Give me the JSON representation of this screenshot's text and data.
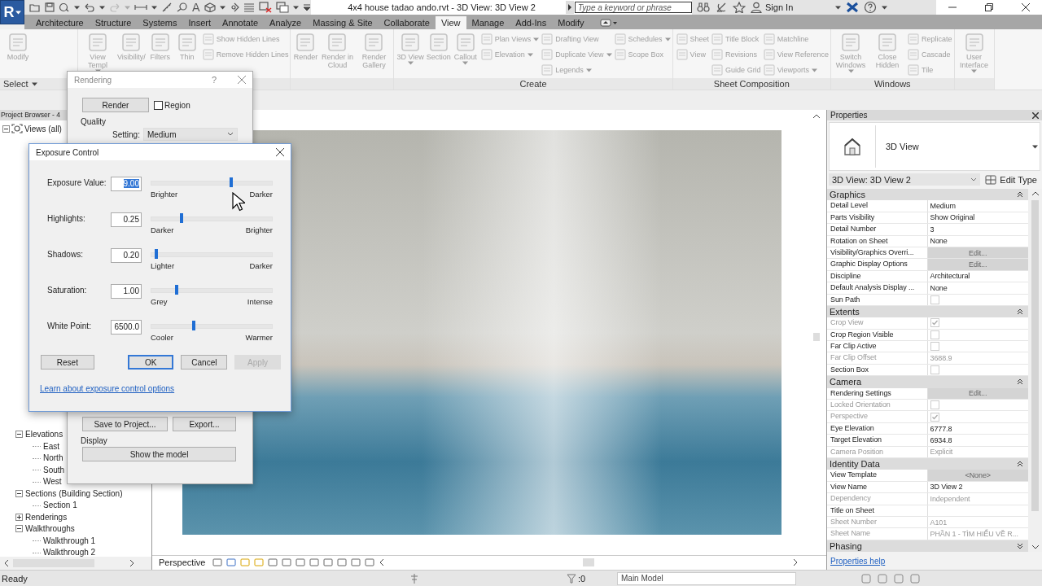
{
  "title_bar": {
    "app_menu": "R",
    "text_tool": "A",
    "title": "4x4 house tadao ando.rvt - 3D View: 3D View 2",
    "search": {
      "placeholder": "Type a keyword or phrase"
    },
    "sign_in": "Sign In"
  },
  "ribbon": {
    "tabs": [
      {
        "label": "Architecture",
        "selected": false
      },
      {
        "label": "Structure",
        "selected": false
      },
      {
        "label": "Systems",
        "selected": false
      },
      {
        "label": "Insert",
        "selected": false
      },
      {
        "label": "Annotate",
        "selected": false
      },
      {
        "label": "Analyze",
        "selected": false
      },
      {
        "label": "Massing & Site",
        "selected": false
      },
      {
        "label": "Collaborate",
        "selected": false
      },
      {
        "label": "View",
        "selected": true
      },
      {
        "label": "Manage",
        "selected": false
      },
      {
        "label": "Add-Ins",
        "selected": false
      },
      {
        "label": "Modify",
        "selected": false
      }
    ],
    "panels": [
      {
        "label": "Select",
        "items": [
          {
            "kind": "large",
            "label": "Modify",
            "menu": false
          }
        ]
      },
      {
        "items": [
          {
            "kind": "large",
            "label": "View Templ",
            "menu": true
          },
          {
            "kind": "large",
            "label": "Visibility/",
            "menu": false
          },
          {
            "kind": "large",
            "label": "Filters",
            "menu": false
          },
          {
            "kind": "large",
            "label": "Thin",
            "menu": false
          },
          {
            "kind": "stack",
            "items": [
              {
                "label": "Show Hidden Lines",
                "menu": false
              },
              {
                "label": "Remove Hidden Lines",
                "menu": false
              }
            ]
          }
        ]
      },
      {
        "items": [
          {
            "kind": "large",
            "label": "Render",
            "menu": false
          },
          {
            "kind": "large",
            "label": "Render in Cloud",
            "menu": false
          },
          {
            "kind": "large",
            "label": "Render Gallery",
            "menu": false
          }
        ]
      },
      {
        "label": "Create",
        "items": [
          {
            "kind": "large",
            "label": "3D View",
            "menu": true
          },
          {
            "kind": "large",
            "label": "Section",
            "menu": false
          },
          {
            "kind": "large",
            "label": "Callout",
            "menu": true
          },
          {
            "kind": "stack",
            "items": [
              {
                "label": "Plan Views",
                "menu": true
              },
              {
                "label": "Elevation",
                "menu": true
              }
            ]
          },
          {
            "kind": "stack",
            "items": [
              {
                "label": "Drafting View",
                "menu": false
              },
              {
                "label": "Duplicate View",
                "menu": true
              },
              {
                "label": "Legends",
                "menu": true
              }
            ]
          },
          {
            "kind": "stack",
            "items": [
              {
                "label": "Schedules",
                "menu": true
              },
              {
                "label": "Scope Box",
                "menu": false
              }
            ]
          }
        ]
      },
      {
        "label": "Sheet Composition",
        "items": [
          {
            "kind": "stack",
            "items": [
              {
                "label": "Sheet",
                "menu": false
              },
              {
                "label": "View",
                "menu": false
              }
            ]
          },
          {
            "kind": "stack",
            "items": [
              {
                "label": "Title Block",
                "menu": false
              },
              {
                "label": "Revisions",
                "menu": false
              },
              {
                "label": "Guide Grid",
                "menu": false
              }
            ]
          },
          {
            "kind": "stack",
            "items": [
              {
                "label": "Matchline",
                "menu": false
              },
              {
                "label": "View Reference",
                "menu": false
              },
              {
                "label": "Viewports",
                "menu": true
              }
            ]
          }
        ]
      },
      {
        "label": "Windows",
        "items": [
          {
            "kind": "large",
            "label": "Switch Windows",
            "menu": true
          },
          {
            "kind": "large",
            "label": "Close Hidden",
            "menu": false
          },
          {
            "kind": "stack",
            "items": [
              {
                "label": "Replicate",
                "menu": false
              },
              {
                "label": "Cascade",
                "menu": false
              },
              {
                "label": "Tile",
                "menu": false
              }
            ]
          }
        ]
      },
      {
        "items": [
          {
            "kind": "large",
            "label": "User Interface",
            "menu": true
          }
        ]
      }
    ]
  },
  "project_browser": {
    "title": "Project Browser - 4",
    "tree": [
      {
        "label": "Views (all)",
        "expanded": true,
        "children": [
          {
            "label": "Elevations",
            "expanded": true,
            "children": [
              {
                "label": "East"
              },
              {
                "label": "North"
              },
              {
                "label": "South"
              },
              {
                "label": "West"
              }
            ]
          },
          {
            "label": "Sections (Building Section)",
            "expanded": true,
            "children": [
              {
                "label": "Section 1"
              }
            ]
          },
          {
            "label": "Renderings",
            "expanded": false
          },
          {
            "label": "Walkthroughs",
            "expanded": true,
            "children": [
              {
                "label": "Walkthrough 1"
              },
              {
                "label": "Walkthrough 2"
              }
            ]
          }
        ]
      }
    ]
  },
  "view": {
    "view_bar": {
      "label": "Perspective"
    }
  },
  "properties": {
    "title": "Properties",
    "type_name": "3D View",
    "instance": "3D View: 3D View 2",
    "edit_type": "Edit Type",
    "groups": [
      {
        "label": "Graphics",
        "expanded": true,
        "rows": [
          {
            "name": "Detail Level",
            "kind": "text",
            "value": "Medium",
            "disabled": false
          },
          {
            "name": "Parts Visibility",
            "kind": "text",
            "value": "Show Original",
            "disabled": false
          },
          {
            "name": "Detail Number",
            "kind": "text",
            "value": "3",
            "disabled": false
          },
          {
            "name": "Rotation on Sheet",
            "kind": "text",
            "value": "None",
            "disabled": false
          },
          {
            "name": "Visibility/Graphics Overri...",
            "kind": "button",
            "value": "Edit...",
            "disabled": false
          },
          {
            "name": "Graphic Display Options",
            "kind": "button",
            "value": "Edit...",
            "disabled": false
          },
          {
            "name": "Discipline",
            "kind": "text",
            "value": "Architectural",
            "disabled": false
          },
          {
            "name": "Default Analysis Display ...",
            "kind": "text",
            "value": "None",
            "disabled": false
          },
          {
            "name": "Sun Path",
            "kind": "checkbox",
            "checked": false,
            "disabled": false
          }
        ]
      },
      {
        "label": "Extents",
        "expanded": true,
        "rows": [
          {
            "name": "Crop View",
            "kind": "checkbox",
            "checked": true,
            "disabled": true
          },
          {
            "name": "Crop Region Visible",
            "kind": "checkbox",
            "checked": false,
            "disabled": false
          },
          {
            "name": "Far Clip Active",
            "kind": "checkbox",
            "checked": false,
            "disabled": false
          },
          {
            "name": "Far Clip Offset",
            "kind": "text",
            "value": "3688.9",
            "disabled": true
          },
          {
            "name": "Section Box",
            "kind": "checkbox",
            "checked": false,
            "disabled": false
          }
        ]
      },
      {
        "label": "Camera",
        "expanded": true,
        "rows": [
          {
            "name": "Rendering Settings",
            "kind": "button",
            "value": "Edit...",
            "disabled": false
          },
          {
            "name": "Locked Orientation",
            "kind": "checkbox",
            "checked": false,
            "disabled": true
          },
          {
            "name": "Perspective",
            "kind": "checkbox",
            "checked": true,
            "disabled": true
          },
          {
            "name": "Eye Elevation",
            "kind": "text",
            "value": "6777.8",
            "disabled": false
          },
          {
            "name": "Target Elevation",
            "kind": "text",
            "value": "6934.8",
            "disabled": false
          },
          {
            "name": "Camera Position",
            "kind": "text",
            "value": "Explicit",
            "disabled": true
          }
        ]
      },
      {
        "label": "Identity Data",
        "expanded": true,
        "rows": [
          {
            "name": "View Template",
            "kind": "button",
            "value": "<None>",
            "disabled": false
          },
          {
            "name": "View Name",
            "kind": "text",
            "value": "3D View 2",
            "disabled": false
          },
          {
            "name": "Dependency",
            "kind": "text",
            "value": "Independent",
            "disabled": true
          },
          {
            "name": "Title on Sheet",
            "kind": "text",
            "value": "",
            "disabled": false
          },
          {
            "name": "Sheet Number",
            "kind": "text",
            "value": "A101",
            "disabled": true
          },
          {
            "name": "Sheet Name",
            "kind": "text",
            "value": "PHẦN 1 - TÌM HIỂU VỀ R...",
            "disabled": true
          }
        ]
      },
      {
        "label": "Phasing",
        "expanded": false
      }
    ],
    "help": "Properties help"
  },
  "status_bar": {
    "message": "Ready",
    "filter_count": ":0",
    "model": "Main Model"
  },
  "rendering_dialog": {
    "title": "Rendering",
    "help": "?",
    "render_button": "Render",
    "region": {
      "label": "Region",
      "checked": false
    },
    "quality_label": "Quality",
    "setting_label": "Setting:",
    "setting_value": "Medium",
    "save_button": "Save to Project...",
    "export_button": "Export...",
    "display_label": "Display",
    "show_button": "Show the model"
  },
  "exposure_dialog": {
    "title": "Exposure Control",
    "rows": [
      {
        "label": "Exposure Value:",
        "value": "9.00",
        "value_selected": true,
        "level": 0.66,
        "left": "Brighter",
        "right": "Darker"
      },
      {
        "label": "Highlights:",
        "value": "0.25",
        "value_selected": false,
        "level": 0.25,
        "left": "Darker",
        "right": "Brighter"
      },
      {
        "label": "Shadows:",
        "value": "0.20",
        "value_selected": false,
        "level": 0.04,
        "left": "Lighter",
        "right": "Darker"
      },
      {
        "label": "Saturation:",
        "value": "1.00",
        "value_selected": false,
        "level": 0.21,
        "left": "Grey",
        "right": "Intense"
      },
      {
        "label": "White Point:",
        "value": "6500.0",
        "value_selected": false,
        "level": 0.35,
        "left": "Cooler",
        "right": "Warmer"
      }
    ],
    "buttons": [
      {
        "label": "Reset",
        "default": false,
        "disabled": false
      },
      {
        "label": "OK",
        "default": true,
        "disabled": false
      },
      {
        "label": "Cancel",
        "default": false,
        "disabled": false
      },
      {
        "label": "Apply",
        "default": false,
        "disabled": true
      }
    ],
    "link": "Learn about exposure control options"
  }
}
